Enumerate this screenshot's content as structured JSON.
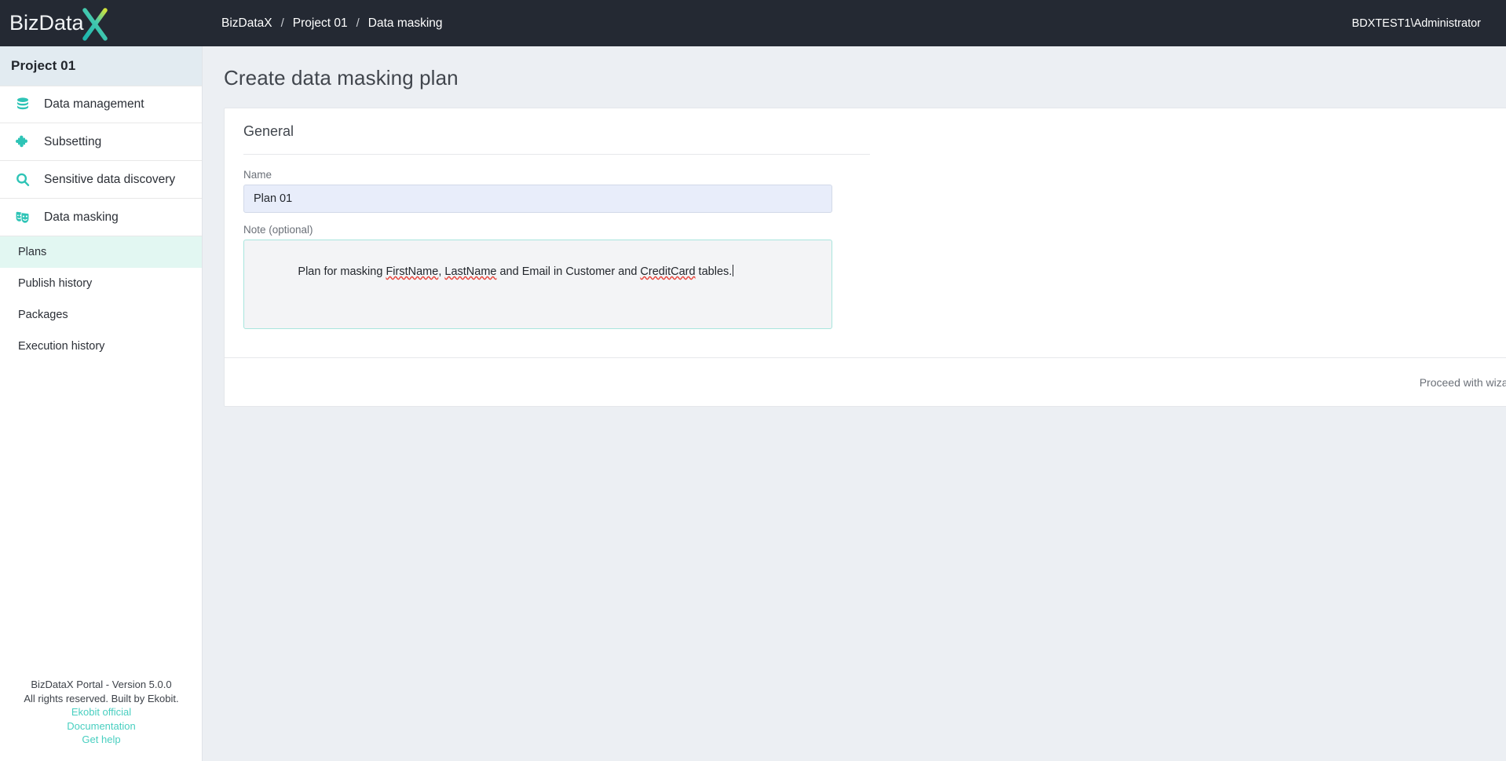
{
  "brand": {
    "name": "BizDataX",
    "word": "BizData",
    "mark": "X"
  },
  "sidebar": {
    "project_title": "Project 01",
    "items": [
      {
        "label": "Data management",
        "icon": "database-icon"
      },
      {
        "label": "Subsetting",
        "icon": "puzzle-piece-icon"
      },
      {
        "label": "Sensitive data discovery",
        "icon": "magnifier-icon"
      },
      {
        "label": "Data masking",
        "icon": "theater-masks-icon"
      }
    ],
    "subitems": [
      {
        "label": "Plans",
        "active": true
      },
      {
        "label": "Publish history",
        "active": false
      },
      {
        "label": "Packages",
        "active": false
      },
      {
        "label": "Execution history",
        "active": false
      }
    ],
    "footer": {
      "version_line": "BizDataX Portal - Version 5.0.0",
      "rights_line": "All rights reserved. Built by Ekobit.",
      "links": [
        "Ekobit official",
        "Documentation",
        "Get help"
      ]
    }
  },
  "topbar": {
    "breadcrumb": [
      "BizDataX",
      "Project 01",
      "Data masking"
    ],
    "separator": "/",
    "user": "BDXTEST1\\Administrator"
  },
  "main": {
    "page_title": "Create data masking plan",
    "card": {
      "section_title": "General",
      "name_field": {
        "label": "Name",
        "value": "Plan 01",
        "placeholder": "Name"
      },
      "note_field": {
        "label": "Note (optional)",
        "value": "Plan for masking FirstName, LastName and Email in Customer and CreditCard tables.",
        "placeholder": "Note",
        "segments": [
          {
            "text": "Plan for masking ",
            "misspelled": false
          },
          {
            "text": "FirstName",
            "misspelled": true
          },
          {
            "text": ", ",
            "misspelled": false
          },
          {
            "text": "LastName",
            "misspelled": true
          },
          {
            "text": " and Email in Customer and ",
            "misspelled": false
          },
          {
            "text": "CreditCard",
            "misspelled": true
          },
          {
            "text": " tables.",
            "misspelled": false
          }
        ]
      },
      "footer": {
        "wizard_label": "Proceed with wizard",
        "wizard_enabled": "on",
        "confirm_icon": "check-icon",
        "cancel_icon": "close-icon"
      }
    }
  },
  "colors": {
    "accent_teal": "#4cd3c2",
    "icon_teal": "#2ec4b6",
    "danger_coral": "#fb8469",
    "dark_header": "#242933",
    "page_bg": "#eceff3",
    "active_sub_bg": "#e2f7f2",
    "project_header_bg": "#e2ebf1",
    "input_bg": "#e8edfa",
    "link_teal": "#49cfc0",
    "spellcheck_red": "#e8443a"
  }
}
